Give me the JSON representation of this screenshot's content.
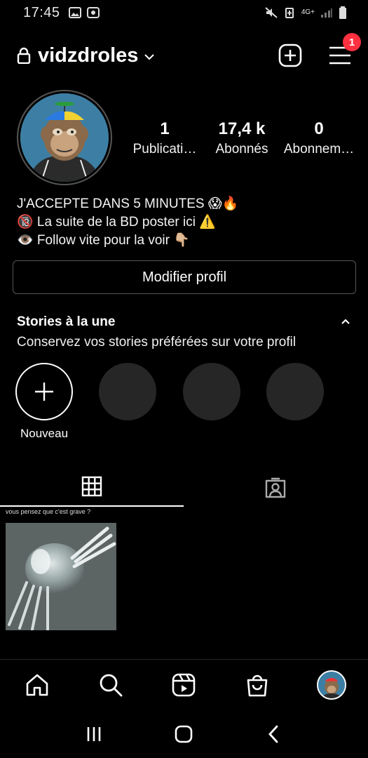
{
  "status_bar": {
    "time": "17:45",
    "left_icons": [
      "image-icon",
      "screen-record-icon"
    ],
    "right_icons": [
      "mute-icon",
      "battery-saver-icon",
      "4g-signal-icon",
      "signal-icon",
      "battery-icon"
    ],
    "network_label": "4G+"
  },
  "header": {
    "username": "vidzdroles",
    "notification_count": "1"
  },
  "stats": [
    {
      "num": "1",
      "label": "Publicati…"
    },
    {
      "num": "17,4 k",
      "label": "Abonnés"
    },
    {
      "num": "0",
      "label": "Abonnem…"
    }
  ],
  "bio": {
    "line1": "J'ACCEPTE DANS 5 MINUTES 😱🔥",
    "line2": "🔞 La suite de la BD poster ici ⚠️",
    "line3": "👁️ Follow vite pour la voir 👇🏼"
  },
  "edit_profile_label": "Modifier profil",
  "stories": {
    "title": "Stories à la une",
    "subtitle": "Conservez vos stories préférées sur votre profil",
    "new_label": "Nouveau"
  },
  "post": {
    "caption": "vous pensez que c'est grave ?"
  },
  "colors": {
    "background": "#000000",
    "badge": "#ff3040",
    "placeholder": "#262626"
  }
}
